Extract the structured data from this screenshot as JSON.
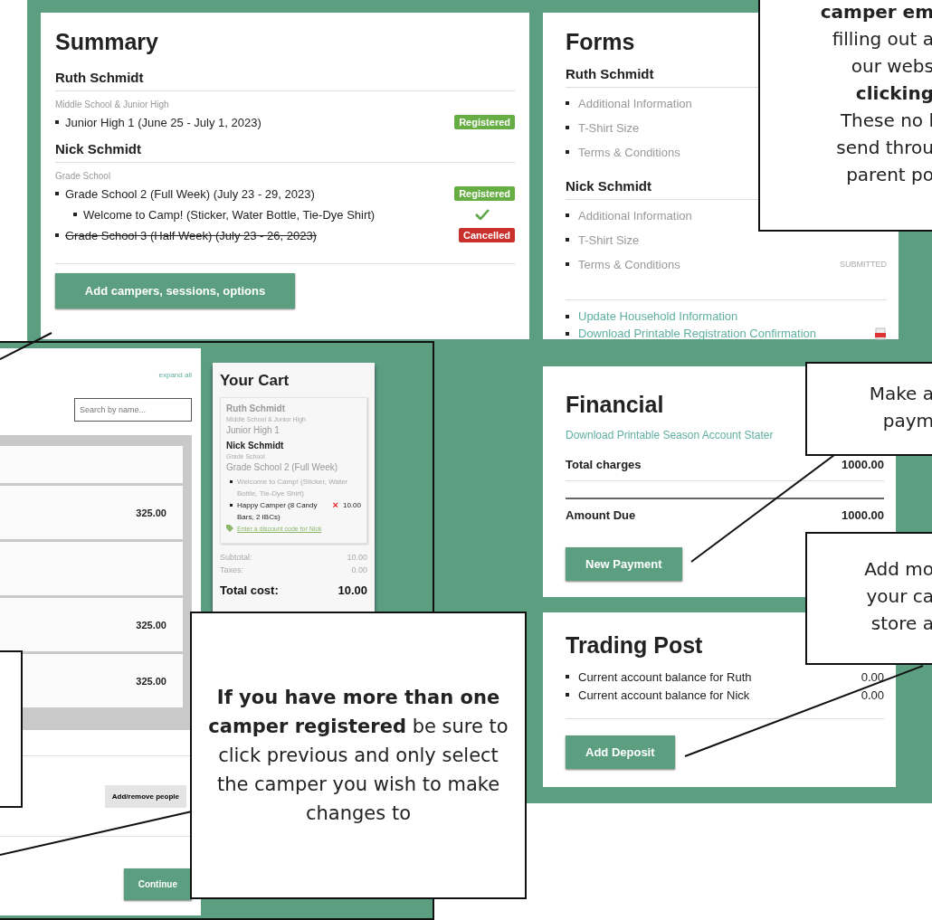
{
  "summary": {
    "title": "Summary",
    "campers": [
      {
        "name": "Ruth Schmidt",
        "group": "Middle School & Junior High",
        "sessions": [
          {
            "label": "Junior High 1 (June 25 - July 1, 2023)",
            "status": {
              "kind": "registered",
              "label": "Registered"
            }
          }
        ]
      },
      {
        "name": "Nick Schmidt",
        "group": "Grade School",
        "sessions": [
          {
            "label": "Grade School 2 (Full Week) (July 23 - 29, 2023)",
            "status": {
              "kind": "registered",
              "label": "Registered"
            },
            "extras": [
              {
                "label": "Welcome to Camp! (Sticker, Water Bottle, Tie-Dye Shirt)",
                "checked": true
              }
            ]
          },
          {
            "label": "Grade School 3 (Half Week) (July 23 - 26, 2023)",
            "status": {
              "kind": "cancelled",
              "label": "Cancelled"
            }
          }
        ]
      }
    ],
    "button": "Add campers, sessions, options"
  },
  "forms": {
    "title": "Forms",
    "campers": [
      {
        "name": "Ruth Schmidt",
        "items": [
          {
            "label": "Additional Information"
          },
          {
            "label": "T-Shirt Size"
          },
          {
            "label": "Terms & Conditions"
          }
        ]
      },
      {
        "name": "Nick Schmidt",
        "items": [
          {
            "label": "Additional Information"
          },
          {
            "label": "T-Shirt Size"
          },
          {
            "label": "Terms & Conditions",
            "status": "SUBMITTED"
          }
        ]
      }
    ],
    "links": [
      {
        "label": "Update Household Information",
        "pdf": false
      },
      {
        "label": "Download Printable Registration Confirmation",
        "pdf": true
      }
    ]
  },
  "financial": {
    "title": "Financial",
    "link": "Download Printable Season Account Stater",
    "rows": [
      {
        "label": "Total charges",
        "value": "1000.00"
      },
      {
        "label": "Amount Due",
        "value": "1000.00"
      }
    ],
    "button": "New Payment"
  },
  "trading_post": {
    "title": "Trading Post",
    "rows": [
      {
        "label": "Current account balance for Ruth",
        "value": "0.00"
      },
      {
        "label": "Current account balance for Nick",
        "value": "0.00"
      }
    ],
    "button": "Add Deposit"
  },
  "registration": {
    "link": "expand all",
    "search": {
      "placeholder": "Search by name..."
    },
    "rows": [
      {
        "kind": "header"
      },
      {
        "kind": "item",
        "price": "325.00"
      },
      {
        "kind": "blank"
      },
      {
        "kind": "item",
        "price": "325.00"
      },
      {
        "kind": "item",
        "price": "325.00"
      }
    ],
    "buttons": [
      "Add/remove people",
      "Continue"
    ]
  },
  "cart": {
    "title": "Your Cart",
    "campers": [
      {
        "name": "Ruth Schmidt",
        "muted": true,
        "group": "Middle School & Junior High",
        "session": "Junior High 1"
      },
      {
        "name": "Nick Schmidt",
        "muted": false,
        "group": "Grade School",
        "session": "Grade School 2 (Full Week)",
        "items": [
          {
            "label": "Welcome to Camp! (Sticker, Water Bottle, Tie-Dye Shirt)",
            "muted": true
          },
          {
            "label": "Happy Camper (8 Candy Bars, 2 IBCs)",
            "price": "10.00",
            "muted": false,
            "remove": "×"
          }
        ],
        "discount": "Enter a discount code for Nick"
      }
    ],
    "totals": [
      {
        "kind": "minor",
        "label": "Subtotal:",
        "value": "10.00"
      },
      {
        "kind": "minor",
        "label": "Taxes:",
        "value": "0.00"
      },
      {
        "kind": "total",
        "label": "Total cost:",
        "value": "10.00"
      }
    ]
  },
  "callouts": [
    {
      "lines": [
        {
          "text": "camper em",
          "bold": true
        },
        {
          "text": "filling out a",
          "bold": false
        },
        {
          "text": "our webs",
          "bold": false
        },
        {
          "text": "clicking",
          "bold": true
        },
        {
          "text": "These no l",
          "bold": false
        },
        {
          "text": "send throu",
          "bold": false
        },
        {
          "text": "parent po",
          "bold": false
        }
      ]
    },
    {
      "lines": [
        {
          "text": "Make a",
          "bold": false
        },
        {
          "text": "paym",
          "bold": false
        }
      ]
    },
    {
      "lines": [
        {
          "text": "Add mo",
          "bold": false
        },
        {
          "text": "your ca",
          "bold": false
        },
        {
          "text": "store a",
          "bold": false
        }
      ]
    },
    {
      "text": "**If you have more than one camper registered** be sure to click previous and only select the camper you wish to make changes to"
    }
  ]
}
